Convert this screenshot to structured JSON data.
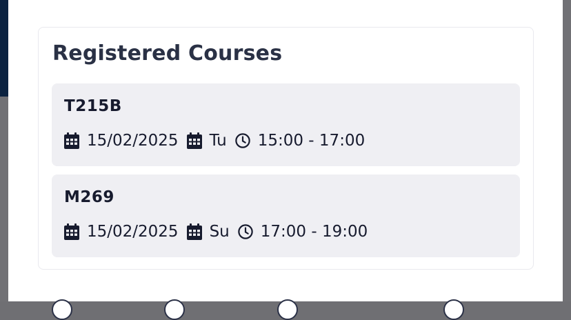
{
  "panel": {
    "title": "Registered Courses"
  },
  "courses": [
    {
      "code": "T215B",
      "date": "15/02/2025",
      "day": "Tu",
      "time": "15:00 - 17:00"
    },
    {
      "code": "M269",
      "date": "15/02/2025",
      "day": "Su",
      "time": "17:00 - 19:00"
    }
  ],
  "colors": {
    "card_bg": "#efeff3",
    "text_dark": "#171b2e",
    "title": "#2a3145"
  }
}
